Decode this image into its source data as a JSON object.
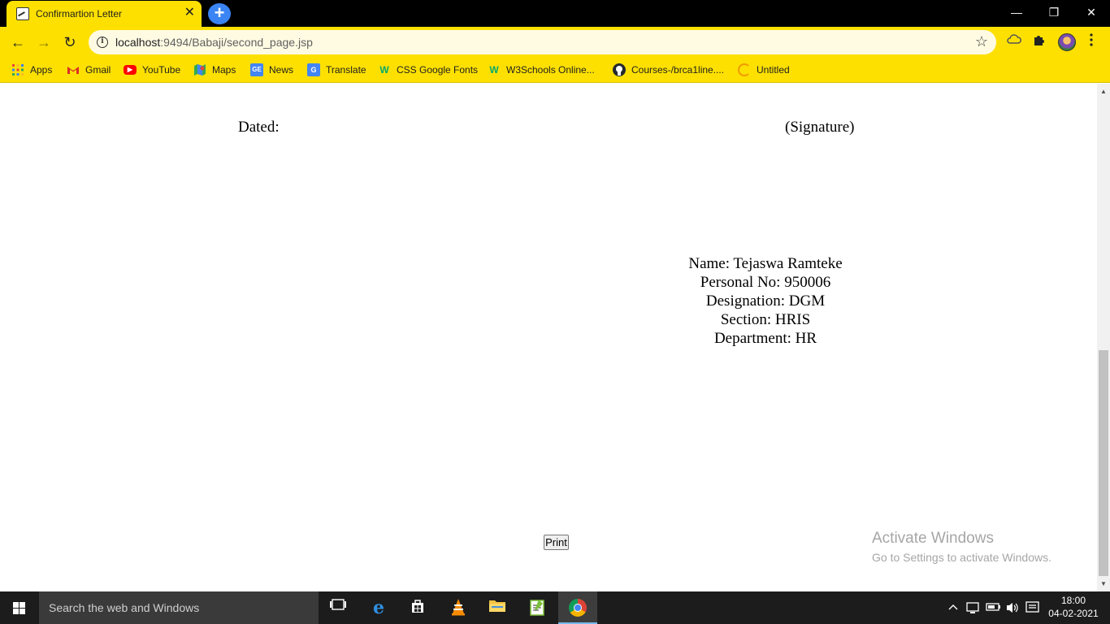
{
  "browser": {
    "tab_title": "Confirmartion Letter",
    "tab_close": "✕",
    "new_tab": "+",
    "window_controls": {
      "minimize": "—",
      "restore": "❐",
      "close": "✕"
    },
    "nav": {
      "back": "←",
      "forward": "→",
      "reload": "↻"
    },
    "url_host": "localhost",
    "url_path": ":9494/Babaji/second_page.jsp",
    "info_icon": "i",
    "star_icon": "☆"
  },
  "bookmarks": [
    {
      "label": "Apps",
      "icon": "apps-grid-icon",
      "color": "#e8453c"
    },
    {
      "label": "Gmail",
      "icon": "gmail-icon",
      "color": "#d93025"
    },
    {
      "label": "YouTube",
      "icon": "youtube-icon",
      "color": "#ff0000"
    },
    {
      "label": "Maps",
      "icon": "maps-icon",
      "color": "#34a853"
    },
    {
      "label": "News",
      "icon": "news-icon",
      "color": "#4285f4"
    },
    {
      "label": "Translate",
      "icon": "translate-icon",
      "color": "#4285f4"
    },
    {
      "label": "CSS Google Fonts",
      "icon": "w3schools-icon",
      "color": "#04aa6d"
    },
    {
      "label": "W3Schools Online...",
      "icon": "w3schools-icon",
      "color": "#04aa6d"
    },
    {
      "label": "Courses-/brca1line....",
      "icon": "github-icon",
      "color": "#24292e"
    },
    {
      "label": "Untitled",
      "icon": "loading-icon",
      "color": "#f29900"
    }
  ],
  "letter": {
    "dated_label": "Dated:",
    "signature_label": "(Signature)",
    "name_line": "Name: Tejaswa Ramteke",
    "personal_no_line": "Personal No: 950006",
    "designation_line": "Designation: DGM",
    "section_line": "Section: HRIS",
    "department_line": "Department: HR",
    "print_button": "Print"
  },
  "watermark": {
    "title": "Activate Windows",
    "subtitle": "Go to Settings to activate Windows."
  },
  "taskbar": {
    "search_placeholder": "Search the web and Windows",
    "time": "18:00",
    "date": "04-02-2021"
  },
  "colors": {
    "browser_theme": "#fde000",
    "titlebar": "#000000",
    "taskbar": "#1c1c1c"
  }
}
